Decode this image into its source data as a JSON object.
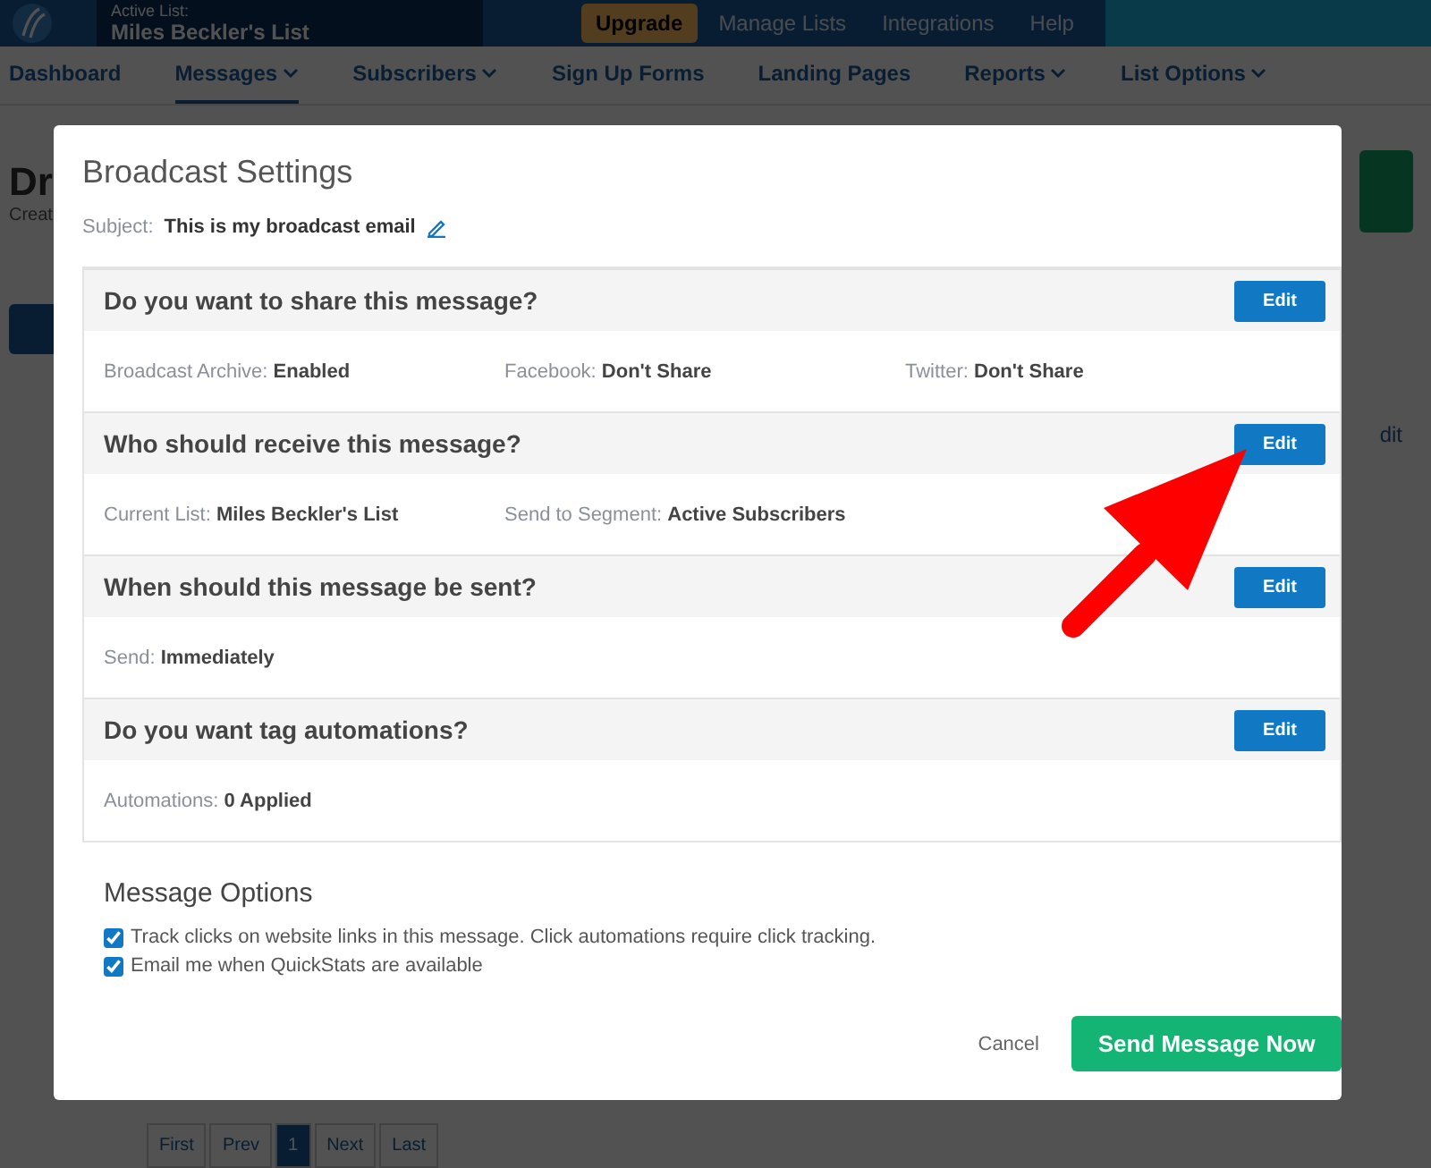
{
  "header": {
    "active_list_label": "Active List:",
    "active_list": "Miles Beckler's List",
    "links": [
      {
        "label": "Upgrade",
        "kind": "highlight"
      },
      {
        "label": "Manage Lists",
        "kind": "plain"
      },
      {
        "label": "Integrations",
        "kind": "plain"
      },
      {
        "label": "Help",
        "kind": "plain"
      }
    ]
  },
  "nav": [
    {
      "label": "Dashboard",
      "dropdown": false,
      "selected": false
    },
    {
      "label": "Messages",
      "dropdown": true,
      "selected": true
    },
    {
      "label": "Subscribers",
      "dropdown": true,
      "selected": false
    },
    {
      "label": "Sign Up Forms",
      "dropdown": false,
      "selected": false
    },
    {
      "label": "Landing Pages",
      "dropdown": false,
      "selected": false
    },
    {
      "label": "Reports",
      "dropdown": true,
      "selected": false
    },
    {
      "label": "List Options",
      "dropdown": true,
      "selected": false
    }
  ],
  "page": {
    "title": "Dr",
    "subtitle": "Creat",
    "column_text": "dit"
  },
  "pagination": [
    {
      "label": "First",
      "selected": false
    },
    {
      "label": "Prev",
      "selected": false
    },
    {
      "label": "1",
      "selected": true
    },
    {
      "label": "Next",
      "selected": false
    },
    {
      "label": "Last",
      "selected": false
    }
  ],
  "modal": {
    "title": "Broadcast Settings",
    "subject_label": "Subject:",
    "subject": "This is my broadcast email",
    "sections": [
      {
        "question": "Do you want to share this message?",
        "button": "Edit",
        "fields": [
          "Broadcast Archive: **Enabled**",
          "Facebook: **Don't Share**",
          "Twitter: **Don't Share**"
        ]
      },
      {
        "question": "Who should receive this message?",
        "button": "Edit",
        "fields": [
          "Current List: **Miles Beckler's List**",
          "Send to Segment: **Active Subscribers**"
        ]
      },
      {
        "question": "When should this message be sent?",
        "button": "Edit",
        "fields": [
          "Send: **Immediately**"
        ]
      },
      {
        "question": "Do you want tag automations?",
        "button": "Edit",
        "fields": [
          "Automations: **0 Applied**"
        ]
      }
    ],
    "options_title": "Message Options",
    "options": [
      {
        "label": "Track clicks on website links in this message. Click automations require click tracking.",
        "checked": true
      },
      {
        "label": "Email me when QuickStats are available",
        "checked": true
      }
    ],
    "cancel": "Cancel",
    "submit": "Send Message Now"
  }
}
